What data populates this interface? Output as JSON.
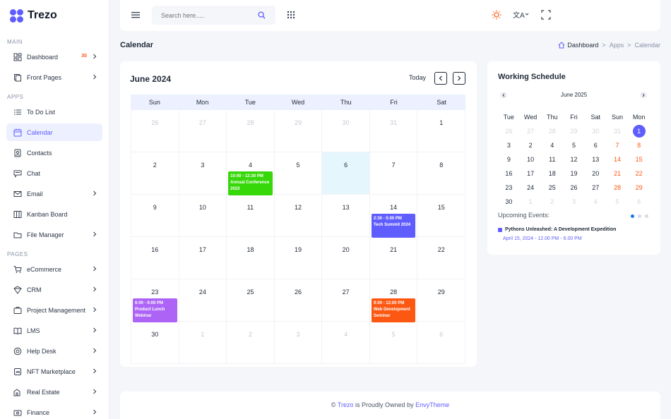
{
  "brand": {
    "name": "Trezo"
  },
  "sidebar": {
    "sections": [
      {
        "label": "MAIN",
        "items": [
          {
            "label": "Dashboard",
            "icon": "dashboard-icon",
            "badge": "30",
            "chevron": true
          },
          {
            "label": "Front Pages",
            "icon": "front-pages-icon",
            "chevron": true
          }
        ]
      },
      {
        "label": "APPS",
        "items": [
          {
            "label": "To Do List",
            "icon": "list-icon"
          },
          {
            "label": "Calendar",
            "icon": "calendar-icon",
            "active": true
          },
          {
            "label": "Contacts",
            "icon": "contacts-icon"
          },
          {
            "label": "Chat",
            "icon": "chat-icon"
          },
          {
            "label": "Email",
            "icon": "email-icon",
            "chevron": true
          },
          {
            "label": "Kanban Board",
            "icon": "kanban-icon"
          },
          {
            "label": "File Manager",
            "icon": "folder-icon",
            "chevron": true
          }
        ]
      },
      {
        "label": "PAGES",
        "items": [
          {
            "label": "eCommerce",
            "icon": "cart-icon",
            "chevron": true
          },
          {
            "label": "CRM",
            "icon": "crm-icon",
            "chevron": true
          },
          {
            "label": "Project Management",
            "icon": "project-icon",
            "chevron": true
          },
          {
            "label": "LMS",
            "icon": "lms-icon",
            "chevron": true
          },
          {
            "label": "Help Desk",
            "icon": "helpdesk-icon",
            "chevron": true
          },
          {
            "label": "NFT Marketplace",
            "icon": "nft-icon",
            "chevron": true
          },
          {
            "label": "Real Estate",
            "icon": "real-estate-icon",
            "chevron": true
          },
          {
            "label": "Finance",
            "icon": "finance-icon",
            "chevron": true
          }
        ]
      }
    ]
  },
  "header": {
    "search_placeholder": "Search here.....",
    "icons": [
      "menu-icon",
      "search-icon",
      "apps-grid-icon",
      "theme-sun-icon",
      "translate-icon",
      "fullscreen-icon"
    ]
  },
  "page": {
    "title": "Calendar",
    "breadcrumb": [
      "Dashboard",
      "Apps",
      "Calendar"
    ],
    "breadcrumb_sep": ">"
  },
  "calendar": {
    "title": "June 2024",
    "today_label": "Today",
    "weekdays": [
      "Sun",
      "Mon",
      "Tue",
      "Wed",
      "Thu",
      "Fri",
      "Sat"
    ],
    "weeks": [
      [
        {
          "d": "26",
          "m": true
        },
        {
          "d": "27",
          "m": true
        },
        {
          "d": "28",
          "m": true
        },
        {
          "d": "29",
          "m": true
        },
        {
          "d": "30",
          "m": true
        },
        {
          "d": "31",
          "m": true
        },
        {
          "d": "1"
        }
      ],
      [
        {
          "d": "2"
        },
        {
          "d": "3"
        },
        {
          "d": "4",
          "ev": {
            "time": "10:00 - 12:30 PM",
            "title": "Annual Conference 2023",
            "color": "#37d80a"
          }
        },
        {
          "d": "5"
        },
        {
          "d": "6",
          "today": true
        },
        {
          "d": "7"
        },
        {
          "d": "8"
        }
      ],
      [
        {
          "d": "9"
        },
        {
          "d": "10"
        },
        {
          "d": "11"
        },
        {
          "d": "12"
        },
        {
          "d": "13"
        },
        {
          "d": "14",
          "ev": {
            "time": "2:30 - 5:00 PM",
            "title": "Tech Summit 2024",
            "color": "#605dff"
          }
        },
        {
          "d": "15"
        }
      ],
      [
        {
          "d": "16"
        },
        {
          "d": "17"
        },
        {
          "d": "18"
        },
        {
          "d": "19"
        },
        {
          "d": "20"
        },
        {
          "d": "21"
        },
        {
          "d": "22"
        }
      ],
      [
        {
          "d": "23",
          "ev": {
            "time": "6:00 - 9:00 PM",
            "title": "Product Lunch Webinar",
            "color": "#ad63f6"
          }
        },
        {
          "d": "24"
        },
        {
          "d": "25"
        },
        {
          "d": "26"
        },
        {
          "d": "27"
        },
        {
          "d": "28",
          "ev": {
            "time": "9:00 - 12:00 PM",
            "title": "Web Development Seminar",
            "color": "#fd5812"
          }
        },
        {
          "d": "29"
        }
      ],
      [
        {
          "d": "30"
        },
        {
          "d": "1",
          "m": true
        },
        {
          "d": "2",
          "m": true
        },
        {
          "d": "3",
          "m": true
        },
        {
          "d": "4",
          "m": true
        },
        {
          "d": "5",
          "m": true
        },
        {
          "d": "6",
          "m": true
        }
      ]
    ]
  },
  "schedule": {
    "title": "Working Schedule",
    "month_label": "June 2025",
    "weekdays": [
      "Tue",
      "Wed",
      "Thu",
      "Fri",
      "Sat",
      "Sun",
      "Mon"
    ],
    "weeks": [
      [
        {
          "d": "26",
          "m": true
        },
        {
          "d": "27",
          "m": true
        },
        {
          "d": "28",
          "m": true
        },
        {
          "d": "29",
          "m": true
        },
        {
          "d": "30",
          "m": true
        },
        {
          "d": "31",
          "m": true
        },
        {
          "d": "1",
          "sel": true
        }
      ],
      [
        {
          "d": "3"
        },
        {
          "d": "2"
        },
        {
          "d": "4"
        },
        {
          "d": "5"
        },
        {
          "d": "6"
        },
        {
          "d": "7",
          "w": true
        },
        {
          "d": "8",
          "w": true
        }
      ],
      [
        {
          "d": "9"
        },
        {
          "d": "10"
        },
        {
          "d": "11"
        },
        {
          "d": "12"
        },
        {
          "d": "13"
        },
        {
          "d": "14",
          "w": true
        },
        {
          "d": "15",
          "w": true
        }
      ],
      [
        {
          "d": "16"
        },
        {
          "d": "17"
        },
        {
          "d": "18"
        },
        {
          "d": "19"
        },
        {
          "d": "20"
        },
        {
          "d": "21",
          "w": true
        },
        {
          "d": "22",
          "w": true
        }
      ],
      [
        {
          "d": "23"
        },
        {
          "d": "24"
        },
        {
          "d": "25"
        },
        {
          "d": "26"
        },
        {
          "d": "27"
        },
        {
          "d": "28",
          "w": true
        },
        {
          "d": "29",
          "w": true
        }
      ],
      [
        {
          "d": "30"
        },
        {
          "d": "1",
          "m": true
        },
        {
          "d": "2",
          "m": true
        },
        {
          "d": "3",
          "m": true
        },
        {
          "d": "4",
          "m": true
        },
        {
          "d": "5",
          "m": true
        },
        {
          "d": "6",
          "m": true
        }
      ]
    ],
    "upcoming_label": "Upcoming Events:",
    "events": [
      {
        "title": "Pythons Unleashed: A Development Expedition",
        "date": "April 15, 2024 - 12.00 PM - 6.00 PM"
      }
    ]
  },
  "footer": {
    "prefix": "©",
    "brand": "Trezo",
    "middle": "is Proudly Owned by",
    "owner": "EnvyTheme"
  },
  "colors": {
    "accent": "#605dff",
    "orange": "#fd5812",
    "green": "#37d80a",
    "purple": "#ad63f6"
  }
}
